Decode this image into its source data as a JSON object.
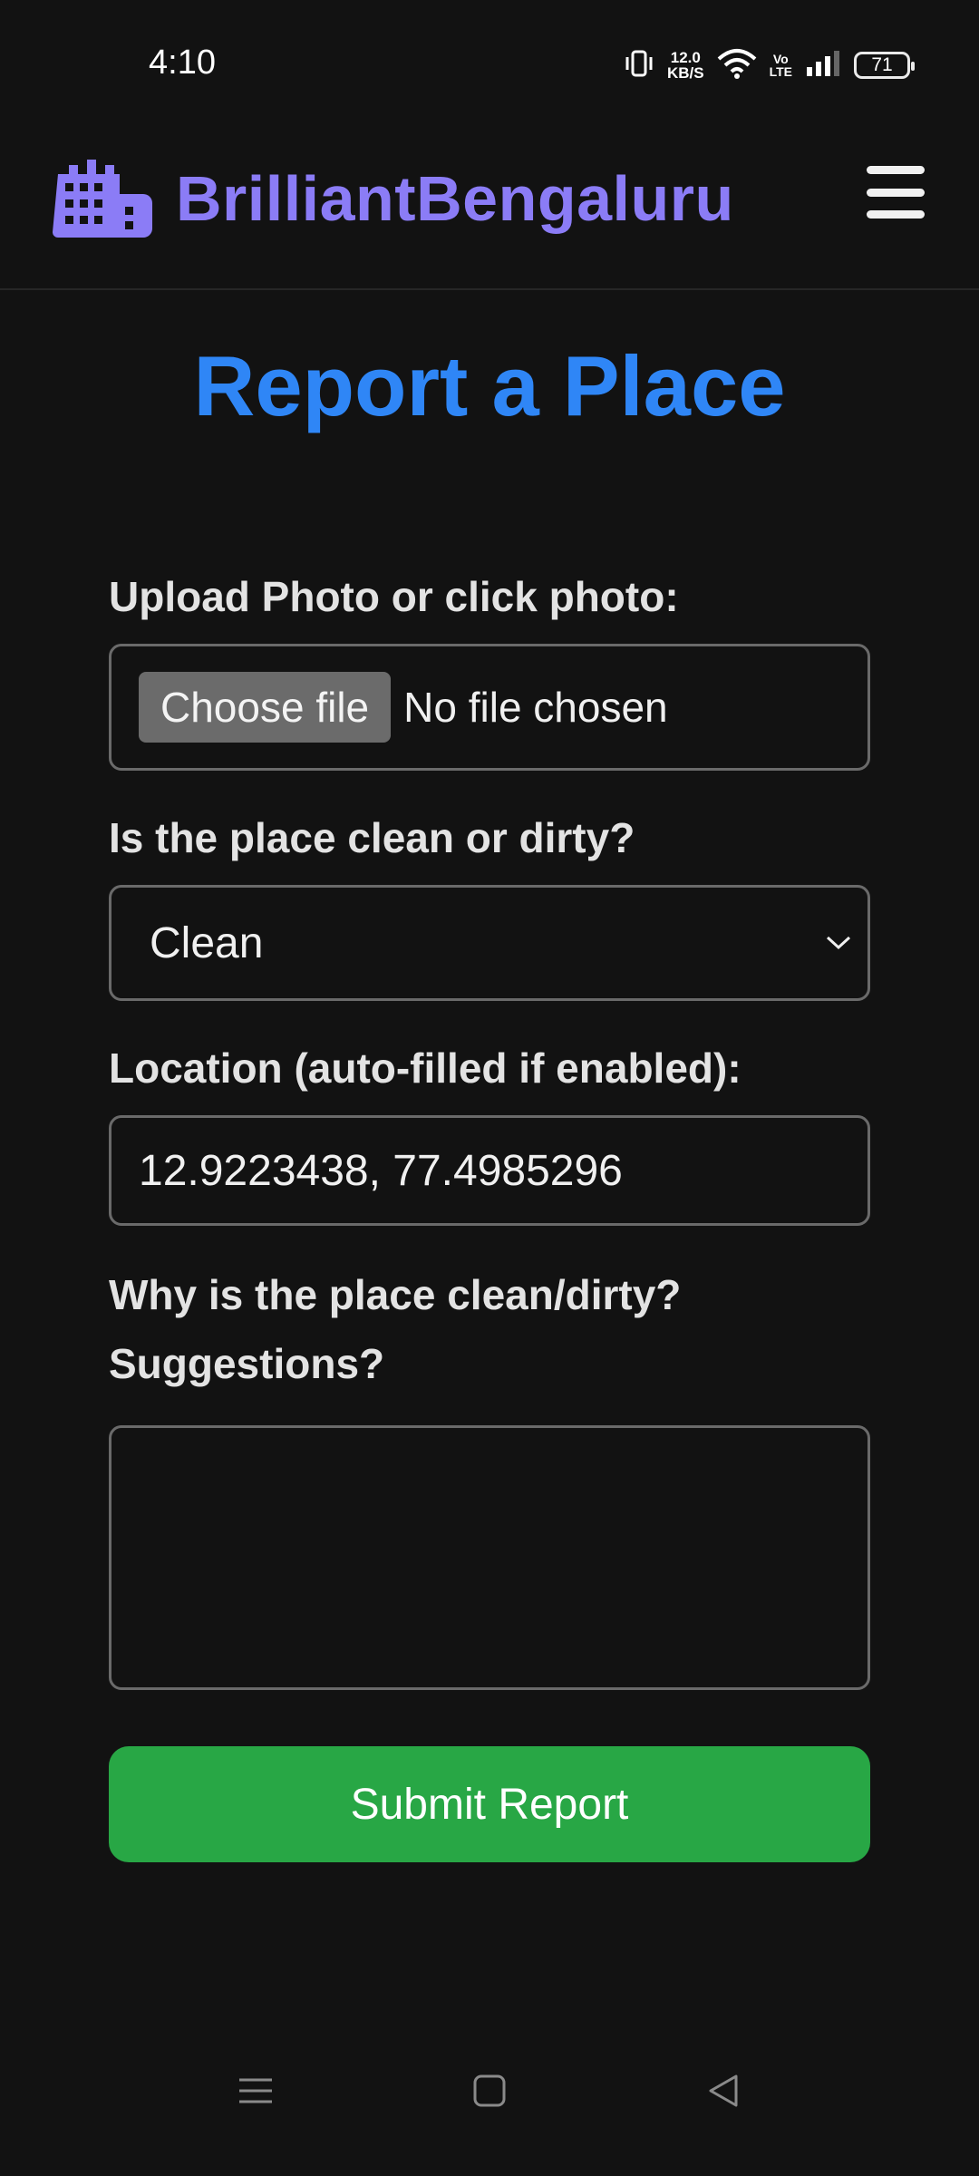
{
  "status_bar": {
    "time": "4:10",
    "net_speed_value": "12.0",
    "net_speed_unit": "KB/S",
    "volte_top": "Vo",
    "volte_bottom": "LTE",
    "battery": "71"
  },
  "header": {
    "brand_title": "BrilliantBengaluru",
    "brand_icon": "city-buildings-icon",
    "menu_icon": "hamburger-menu-icon",
    "brand_color": "#8b7cf6"
  },
  "page": {
    "title": "Report a Place",
    "title_color": "#2f86f6"
  },
  "form": {
    "photo_label": "Upload Photo or click photo:",
    "choose_file_label": "Choose file",
    "no_file_text": "No file chosen",
    "condition_label": "Is the place clean or dirty?",
    "condition_selected": "Clean",
    "location_label": "Location (auto-filled if enabled):",
    "location_value": "12.9223438, 77.4985296",
    "reason_label_line1": "Why is the place clean/dirty?",
    "reason_label_line2": "Suggestions?",
    "reason_value": "",
    "submit_label": "Submit Report",
    "submit_color": "#28a745"
  },
  "nav_bar": {
    "items": [
      "recents-icon",
      "home-icon",
      "back-icon"
    ]
  }
}
